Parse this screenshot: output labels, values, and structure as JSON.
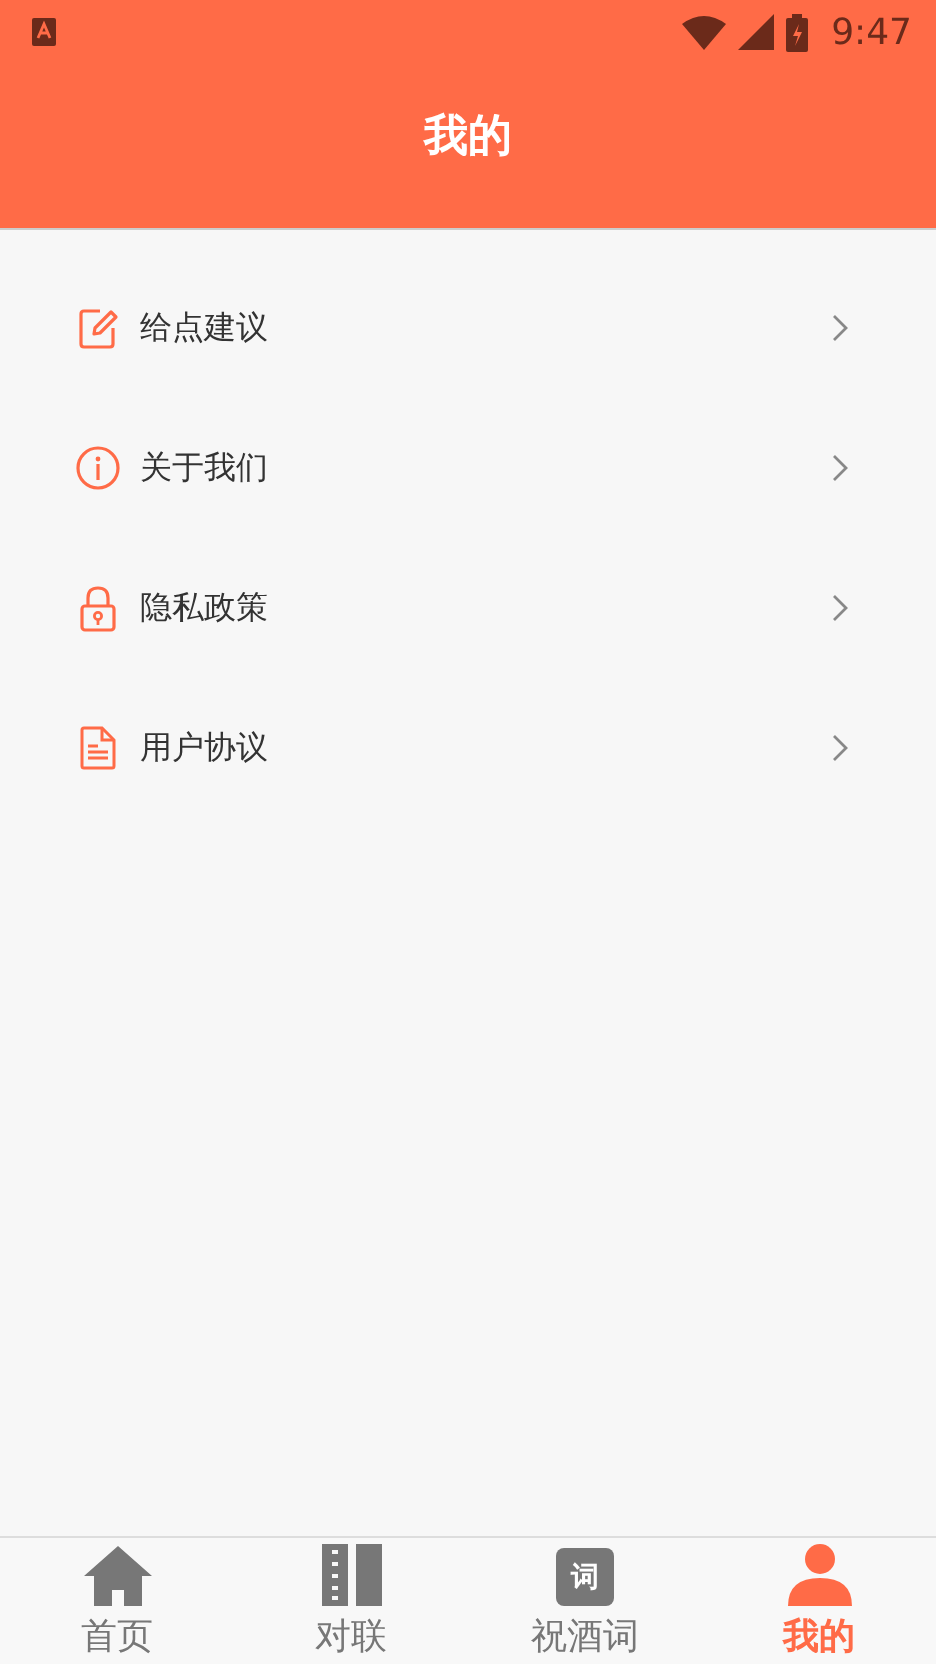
{
  "status_bar": {
    "time": "9:47"
  },
  "header": {
    "title": "我的"
  },
  "menu": [
    {
      "label": "给点建议",
      "kind": "edit"
    },
    {
      "label": "关于我们",
      "kind": "info"
    },
    {
      "label": "隐私政策",
      "kind": "lock"
    },
    {
      "label": "用户协议",
      "kind": "document"
    }
  ],
  "tab_bar": [
    {
      "label": "首页",
      "kind": "home",
      "selected": false
    },
    {
      "label": "对联",
      "kind": "columns",
      "selected": false
    },
    {
      "label": "祝酒词",
      "kind": "badge",
      "badge_text": "词",
      "selected": false
    },
    {
      "label": "我的",
      "kind": "person",
      "selected": true
    }
  ]
}
